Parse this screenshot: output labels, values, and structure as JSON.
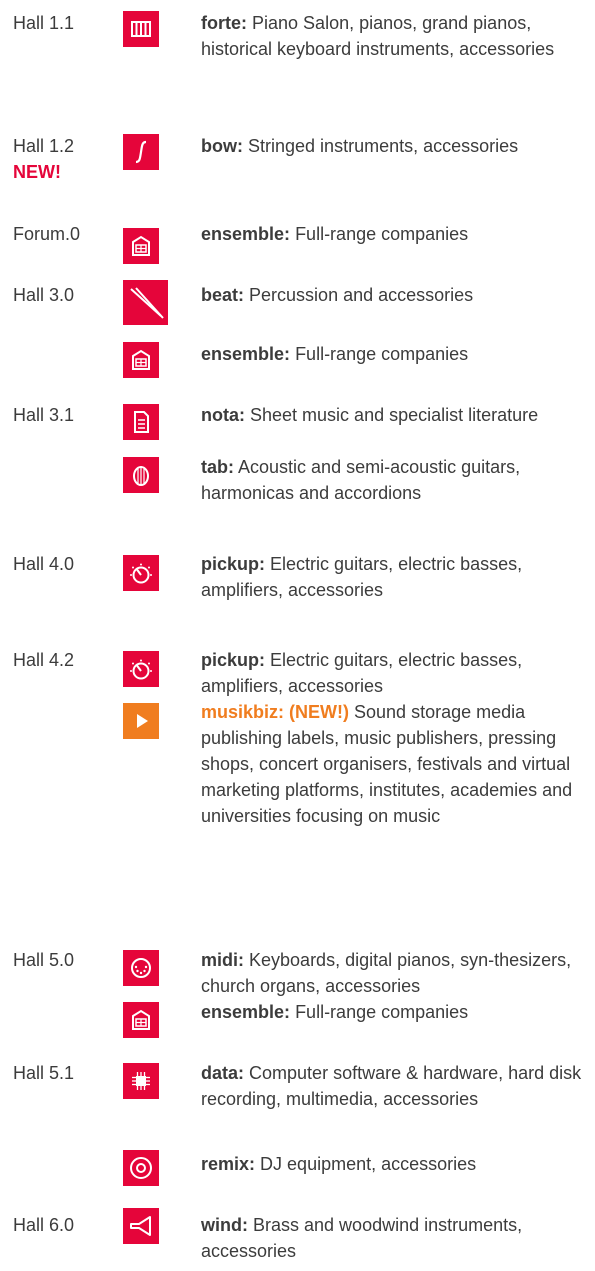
{
  "colors": {
    "accent_red": "#e5053a",
    "accent_orange": "#f07d1f",
    "text": "#3c3c3c"
  },
  "halls": {
    "h11": "Hall 1.1",
    "h12": "Hall 1.2",
    "h12_badge": "NEW!",
    "forum0": "Forum.0",
    "h30": "Hall 3.0",
    "h31": "Hall 3.1",
    "h40": "Hall 4.0",
    "h42": "Hall 4.2",
    "h50": "Hall 5.0",
    "h51": "Hall 5.1",
    "h60": "Hall 6.0"
  },
  "entries": {
    "forte": {
      "name": "forte:",
      "text": "Piano Salon, pianos, grand pianos, historical keyboard instruments, accessories",
      "icon": "piano-keys-icon"
    },
    "bow": {
      "name": "bow:",
      "text": "Stringed instruments, accessories",
      "icon": "f-hole-icon"
    },
    "ensemble_forum": {
      "name": "ensemble:",
      "text": "Full-range companies",
      "icon": "building-icon"
    },
    "beat": {
      "name": "beat:",
      "text": "Percussion and accessories",
      "icon": "drumsticks-icon"
    },
    "ensemble_h30": {
      "name": "ensemble:",
      "text": "Full-range companies",
      "icon": "building-icon"
    },
    "nota": {
      "name": "nota:",
      "text": "Sheet music and specialist literature",
      "icon": "sheet-icon"
    },
    "tab": {
      "name": "tab:",
      "text": "Acoustic and semi-acoustic guitars, harmonicas and accordions",
      "icon": "guitar-icon"
    },
    "pickup_h40": {
      "name": "pickup:",
      "text": "Electric guitars, electric basses, amplifiers, accessories",
      "icon": "knob-icon"
    },
    "pickup_h42": {
      "name": "pickup:",
      "text": "Electric guitars, electric basses, amplifiers, accessories",
      "icon": "knob-icon"
    },
    "musikbiz": {
      "name": "musikbiz: (NEW!)",
      "text": "Sound storage media publishing labels, music publishers, pressing shops, concert organisers, festivals and virtual marketing platforms, institutes, academies and universities focusing on music",
      "icon": "play-icon"
    },
    "midi": {
      "name": "midi:",
      "text": "Keyboards, digital pianos, syn-thesizers, church organs, accessories",
      "icon": "midi-connector-icon"
    },
    "ensemble_h50": {
      "name": "ensemble:",
      "text": "Full-range companies",
      "icon": "building-icon"
    },
    "data": {
      "name": "data:",
      "text": "Computer software & hardware, hard disk recording, multimedia, accessories",
      "icon": "chip-icon"
    },
    "remix": {
      "name": "remix:",
      "text": "DJ equipment, accessories",
      "icon": "vinyl-icon"
    },
    "wind": {
      "name": "wind:",
      "text": "Brass and woodwind instruments, accessories",
      "icon": "horn-icon"
    }
  }
}
